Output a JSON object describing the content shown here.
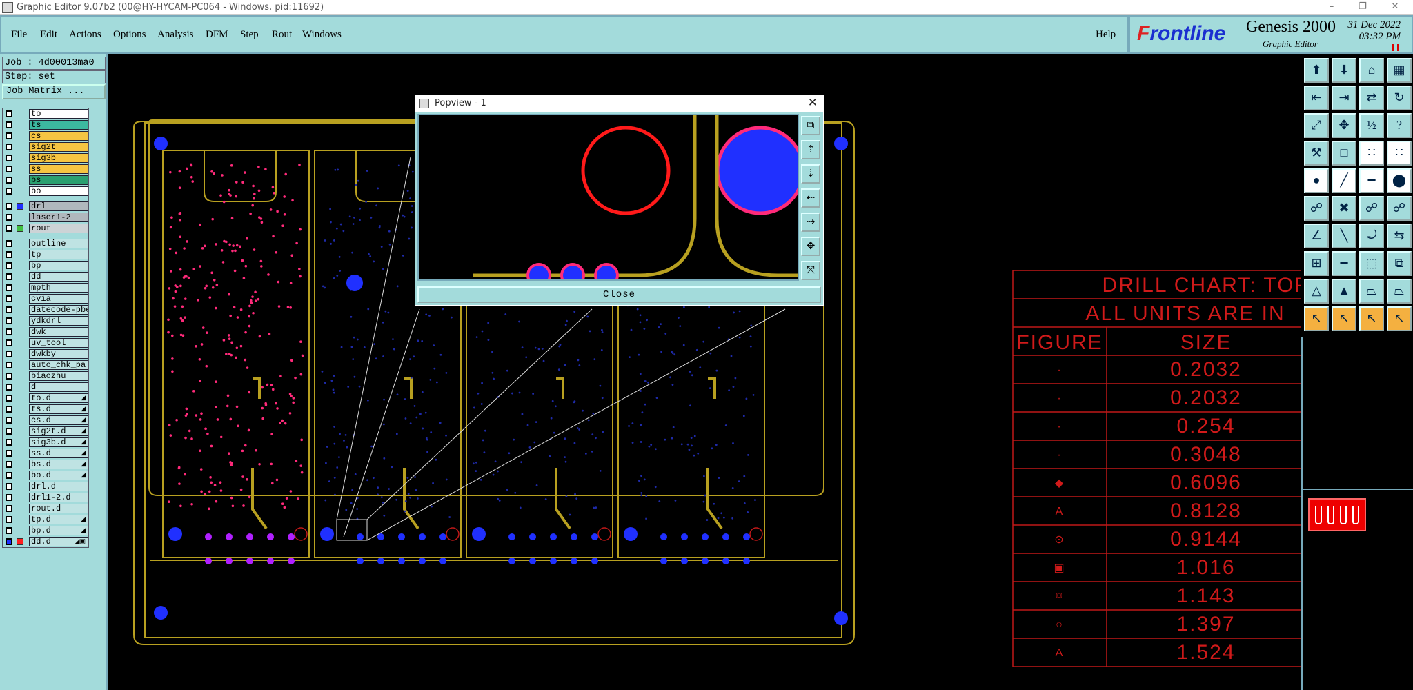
{
  "window": {
    "title": "Graphic Editor 9.07b2 (00@HY-HYCAM-PC064 - Windows, pid:11692)",
    "minimize": "–",
    "restore": "❐",
    "close": "✕"
  },
  "menu": {
    "items": [
      "File",
      "Edit",
      "Actions",
      "Options",
      "Analysis",
      "DFM",
      "Step",
      "Rout",
      "Windows"
    ],
    "help": "Help"
  },
  "brand": {
    "logo_f": "F",
    "logo_rest": "rontline",
    "product": "Genesis 2000",
    "subtitle": "Graphic Editor",
    "date": "31 Dec 2022",
    "time": "03:32 PM"
  },
  "job": {
    "job_label": "Job : 4d00013ma0",
    "step_label": "Step: set",
    "matrix_button": "Job Matrix ..."
  },
  "layers": [
    {
      "name": "to",
      "style": "w",
      "swatch": ""
    },
    {
      "name": "ts",
      "style": "c",
      "swatch": ""
    },
    {
      "name": "cs",
      "style": "y",
      "swatch": ""
    },
    {
      "name": "sig2t",
      "style": "y",
      "swatch": ""
    },
    {
      "name": "sig3b",
      "style": "y",
      "swatch": ""
    },
    {
      "name": "ss",
      "style": "y",
      "swatch": ""
    },
    {
      "name": "bs",
      "style": "g",
      "swatch": ""
    },
    {
      "name": "bo",
      "style": "w",
      "swatch": ""
    },
    {
      "gap": true
    },
    {
      "name": "drl",
      "style": "gr",
      "swatch": "#2030ff"
    },
    {
      "name": "laser1-2",
      "style": "gr",
      "swatch": ""
    },
    {
      "name": "rout",
      "style": "gr2",
      "swatch": "#40c040"
    },
    {
      "gap": true
    },
    {
      "name": "outline",
      "style": "",
      "swatch": ""
    },
    {
      "name": "tp",
      "style": "",
      "swatch": ""
    },
    {
      "name": "bp",
      "style": "",
      "swatch": ""
    },
    {
      "name": "dd",
      "style": "",
      "swatch": ""
    },
    {
      "name": "mpth",
      "style": "",
      "swatch": ""
    },
    {
      "name": "cvia",
      "style": "",
      "swatch": ""
    },
    {
      "name": "datecode-pbe",
      "style": "",
      "swatch": ""
    },
    {
      "name": "ydkdrl",
      "style": "",
      "swatch": ""
    },
    {
      "name": "dwk",
      "style": "",
      "swatch": ""
    },
    {
      "name": "uv_tool",
      "style": "",
      "swatch": ""
    },
    {
      "name": "dwkby",
      "style": "",
      "swatch": ""
    },
    {
      "name": "auto_chk_pa",
      "style": "",
      "swatch": ""
    },
    {
      "name": "biaozhu",
      "style": "",
      "swatch": ""
    },
    {
      "name": "d",
      "style": "",
      "swatch": ""
    },
    {
      "name": "to.d",
      "style": "",
      "swatch": "",
      "dd": true
    },
    {
      "name": "ts.d",
      "style": "",
      "swatch": "",
      "dd": true
    },
    {
      "name": "cs.d",
      "style": "",
      "swatch": "",
      "dd": true
    },
    {
      "name": "sig2t.d",
      "style": "",
      "swatch": "",
      "dd": true
    },
    {
      "name": "sig3b.d",
      "style": "",
      "swatch": "",
      "dd": true
    },
    {
      "name": "ss.d",
      "style": "",
      "swatch": "",
      "dd": true
    },
    {
      "name": "bs.d",
      "style": "",
      "swatch": "",
      "dd": true
    },
    {
      "name": "bo.d",
      "style": "",
      "swatch": "",
      "dd": true
    },
    {
      "name": "drl.d",
      "style": "",
      "swatch": ""
    },
    {
      "name": "drl1-2.d",
      "style": "",
      "swatch": ""
    },
    {
      "name": "rout.d",
      "style": "",
      "swatch": ""
    },
    {
      "name": "tp.d",
      "style": "",
      "swatch": "",
      "dd": true
    },
    {
      "name": "bp.d",
      "style": "",
      "swatch": "",
      "dd": true
    },
    {
      "name": "dd.d",
      "style": "",
      "swatch": "#ff2020",
      "dd": true,
      "active": true
    }
  ],
  "popview": {
    "title": "Popview - 1",
    "close_button": "Close"
  },
  "drill_chart": {
    "title1": "DRILL CHART: TOP",
    "title2": "ALL UNITS ARE IN",
    "col_figure": "FIGURE",
    "col_size": "SIZE",
    "rows": [
      {
        "symbol": "·",
        "size": "0.2032"
      },
      {
        "symbol": "·",
        "size": "0.2032"
      },
      {
        "symbol": "·",
        "size": "0.254"
      },
      {
        "symbol": "·",
        "size": "0.3048"
      },
      {
        "symbol": "◆",
        "size": "0.6096"
      },
      {
        "symbol": "A",
        "size": "0.8128"
      },
      {
        "symbol": "⊙",
        "size": "0.9144"
      },
      {
        "symbol": "▣",
        "size": "1.016"
      },
      {
        "symbol": "⌑",
        "size": "1.143"
      },
      {
        "symbol": "○",
        "size": "1.397"
      },
      {
        "symbol": "A",
        "size": "1.524"
      }
    ]
  },
  "colors": {
    "panel": "#a3dbdb",
    "outline": "#b8a020",
    "pad_magenta": "#ff2a7a",
    "via_blue": "#2030ff",
    "chart_red": "#ff2020"
  },
  "toolbox": [
    {
      "name": "snapshot-tool-icon",
      "glyph": "⬆",
      "style": ""
    },
    {
      "name": "load-tool-icon",
      "glyph": "⬇",
      "style": ""
    },
    {
      "name": "home-tool-icon",
      "glyph": "⌂",
      "style": ""
    },
    {
      "name": "grid-tool-icon",
      "glyph": "▦",
      "style": ""
    },
    {
      "name": "import-left-icon",
      "glyph": "⇤",
      "style": ""
    },
    {
      "name": "import-right-icon",
      "glyph": "⇥",
      "style": ""
    },
    {
      "name": "mirror-tool-icon",
      "glyph": "⇄",
      "style": ""
    },
    {
      "name": "rotate-tool-icon",
      "glyph": "↻",
      "style": ""
    },
    {
      "name": "zoom-home-icon",
      "glyph": "⤢",
      "style": ""
    },
    {
      "name": "zoom-fit-icon",
      "glyph": "✥",
      "style": ""
    },
    {
      "name": "zoom-ratio-icon",
      "glyph": "½",
      "style": ""
    },
    {
      "name": "help-tool-icon",
      "glyph": "?",
      "style": ""
    },
    {
      "name": "measure-tool-icon",
      "glyph": "⚒",
      "style": ""
    },
    {
      "name": "grid-off-icon",
      "glyph": "□",
      "style": ""
    },
    {
      "name": "net-tool-icon",
      "glyph": "∷",
      "style": "w"
    },
    {
      "name": "net-alt-tool-icon",
      "glyph": "∷",
      "style": "w"
    },
    {
      "name": "select-pad-icon",
      "glyph": "●",
      "style": "w"
    },
    {
      "name": "select-line-icon",
      "glyph": "╱",
      "style": "w"
    },
    {
      "name": "ruler-tool-icon",
      "glyph": "━",
      "style": "w"
    },
    {
      "name": "circle-tool-icon",
      "glyph": "⬤",
      "style": "w"
    },
    {
      "name": "connect-tool-icon",
      "glyph": "☍",
      "style": ""
    },
    {
      "name": "cross-tool-icon",
      "glyph": "✖",
      "style": ""
    },
    {
      "name": "arc-connect-icon",
      "glyph": "☍",
      "style": ""
    },
    {
      "name": "arc-connect-alt-icon",
      "glyph": "☍",
      "style": ""
    },
    {
      "name": "angle-tool-icon",
      "glyph": "∠",
      "style": ""
    },
    {
      "name": "diagonal-tool-icon",
      "glyph": "╲",
      "style": ""
    },
    {
      "name": "arc-tool-icon",
      "glyph": "⤾",
      "style": ""
    },
    {
      "name": "flip-tool-icon",
      "glyph": "⇆",
      "style": ""
    },
    {
      "name": "add-pad-icon",
      "glyph": "⊞",
      "style": ""
    },
    {
      "name": "add-line-icon",
      "glyph": "━",
      "style": ""
    },
    {
      "name": "bbox-tool-icon",
      "glyph": "⬚",
      "style": ""
    },
    {
      "name": "copy-tool-icon",
      "glyph": "⧉",
      "style": ""
    },
    {
      "name": "triangle-tool-icon",
      "glyph": "△",
      "style": ""
    },
    {
      "name": "triangle-alt-icon",
      "glyph": "▲",
      "style": ""
    },
    {
      "name": "trapezoid-tool-icon",
      "glyph": "⏢",
      "style": ""
    },
    {
      "name": "trapezoid-alt-icon",
      "glyph": "⏢",
      "style": ""
    },
    {
      "name": "pointer-tool-icon",
      "glyph": "↖",
      "style": "o"
    },
    {
      "name": "pointer-select-icon",
      "glyph": "↖",
      "style": "o"
    },
    {
      "name": "pointer-add-icon",
      "glyph": "↖",
      "style": "o"
    },
    {
      "name": "pointer-multi-icon",
      "glyph": "↖",
      "style": "o"
    }
  ]
}
